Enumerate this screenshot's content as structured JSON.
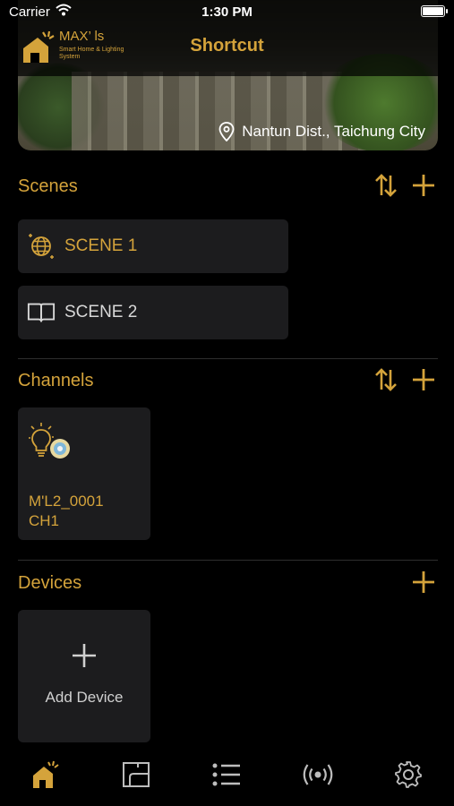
{
  "status_bar": {
    "carrier": "Carrier",
    "time": "1:30 PM",
    "battery_level": 1.0
  },
  "header": {
    "logo_name": "MAX’ ls",
    "logo_sub": "Smart Home & Lighting System",
    "title": "Shortcut"
  },
  "hero": {
    "location": "Nantun Dist., Taichung City"
  },
  "colors": {
    "accent": "#d4a33b",
    "card_bg": "#1c1c1e",
    "background": "#000000"
  },
  "scenes": {
    "section_label": "Scenes",
    "items": [
      {
        "label": "SCENE 1",
        "icon": "disco-ball-icon"
      },
      {
        "label": "SCENE 2",
        "icon": "open-book-icon"
      }
    ]
  },
  "channels": {
    "section_label": "Channels",
    "items": [
      {
        "label_line1": "M'L2_0001",
        "label_line2": "CH1",
        "icon": "bulb-icon"
      }
    ]
  },
  "devices": {
    "section_label": "Devices",
    "add_label": "Add Device"
  },
  "tab_bar": {
    "tabs": [
      {
        "icon": "home-shortcut-icon",
        "selected": true
      },
      {
        "icon": "floor-plan-icon",
        "selected": false
      },
      {
        "icon": "list-icon",
        "selected": false
      },
      {
        "icon": "broadcast-icon",
        "selected": false
      },
      {
        "icon": "gear-icon",
        "selected": false
      }
    ]
  }
}
